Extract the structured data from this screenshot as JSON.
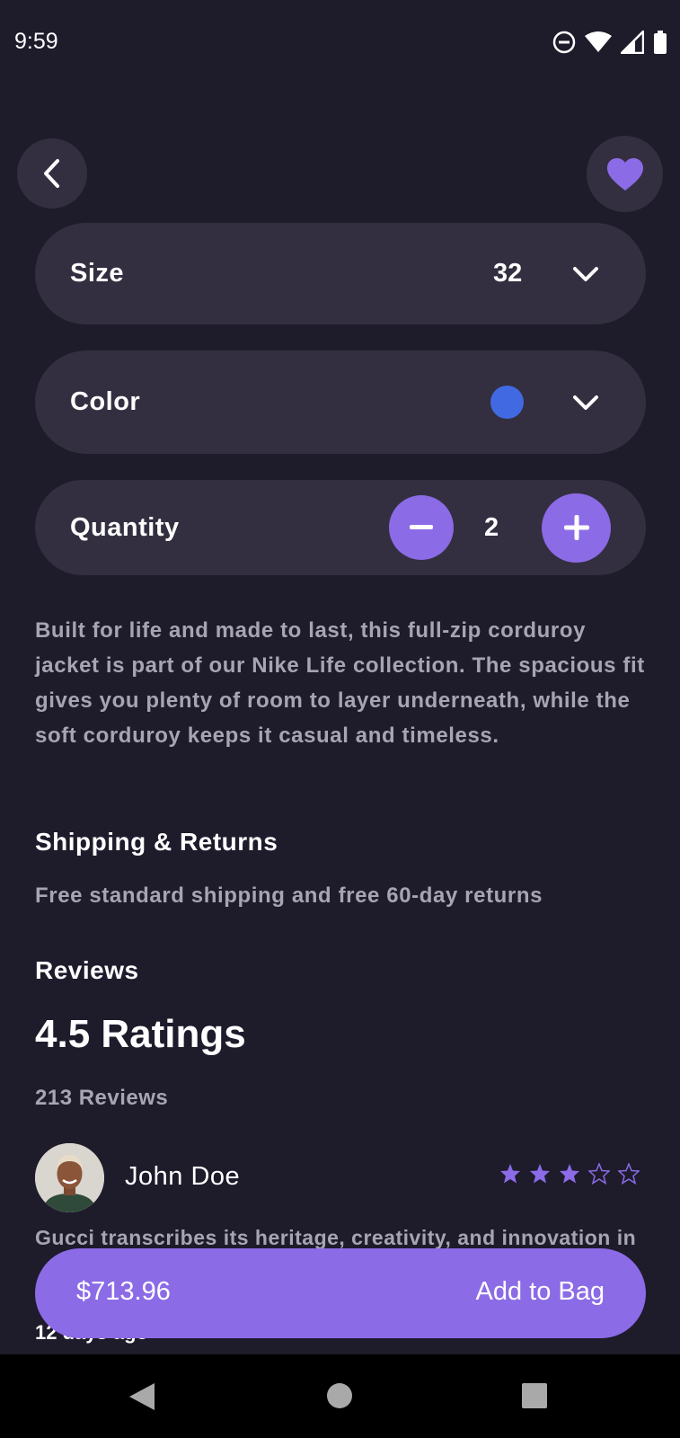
{
  "status_bar": {
    "time": "9:59",
    "icons": [
      "do-not-disturb-icon",
      "wifi-icon",
      "signal-icon",
      "battery-icon"
    ]
  },
  "header": {
    "back_icon": "chevron-left-icon",
    "favorite_icon": "heart-icon"
  },
  "options": {
    "size": {
      "label": "Size",
      "value": "32"
    },
    "color": {
      "label": "Color",
      "swatch": "#4169e1"
    },
    "quantity": {
      "label": "Quantity",
      "value": "2"
    }
  },
  "description": "Built for life and made to last, this full-zip corduroy jacket is part of our Nike Life collection. The spacious fit gives you plenty of room to layer underneath, while the soft corduroy keeps it casual and timeless.",
  "shipping": {
    "heading": "Shipping & Returns",
    "text": "Free standard shipping and free 60-day returns"
  },
  "reviews": {
    "heading": "Reviews",
    "rating_title": "4.5 Ratings",
    "count": "213 Reviews",
    "items": [
      {
        "name": "John Doe",
        "stars": 3,
        "max_stars": 5,
        "text": "Gucci transcribes its heritage, creativity, and innovation in",
        "date": "12 days ago"
      }
    ]
  },
  "cta": {
    "price": "$713.96",
    "label": "Add to Bag"
  },
  "colors": {
    "background": "#1e1b2b",
    "surface": "#332f40",
    "accent": "#8b6be6",
    "muted_text": "#a7a4b3"
  }
}
